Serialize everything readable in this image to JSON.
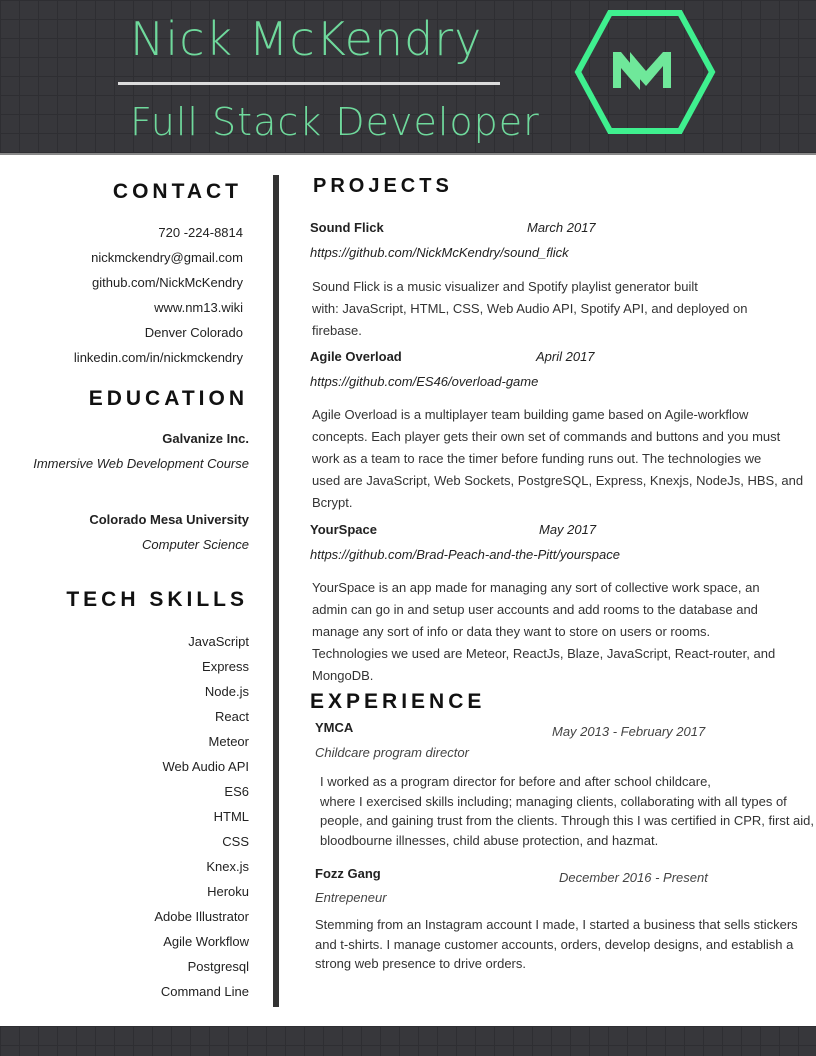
{
  "header": {
    "name": "Nick McKendry",
    "title": "Full Stack Developer",
    "logo_text": "NM",
    "accent": "#3ff08f"
  },
  "contact": {
    "heading": "CONTACT",
    "items": [
      "720 -224-8814",
      "nickmckendry@gmail.com",
      "github.com/NickMcKendry",
      "www.nm13.wiki",
      "Denver Colorado",
      "linkedin.com/in/nickmckendry"
    ]
  },
  "education": {
    "heading": "EDUCATION",
    "items": [
      {
        "school": "Galvanize Inc.",
        "program": "Immersive Web Development Course"
      },
      {
        "school": "Colorado Mesa University",
        "program": "Computer Science"
      }
    ]
  },
  "skills": {
    "heading": "TECH SKILLS",
    "items": [
      "JavaScript",
      "Express",
      "Node.js",
      "React",
      "Meteor",
      "Web Audio API",
      "ES6",
      "HTML",
      "CSS",
      "Knex.js",
      "Heroku",
      "Adobe Illustrator",
      "Agile Workflow",
      "Postgresql",
      "Command Line"
    ]
  },
  "projects": {
    "heading": "PROJECTS",
    "items": [
      {
        "name": "Sound Flick",
        "date": "March 2017",
        "url": "https://github.com/NickMcKendry/sound_flick",
        "lines": [
          "Sound Flick is a music visualizer and Spotify playlist generator built",
          "with: JavaScript, HTML, CSS, Web Audio API, Spotify API, and deployed on",
          "firebase."
        ]
      },
      {
        "name": "Agile Overload",
        "date": "April 2017",
        "url": "https://github.com/ES46/overload-game",
        "lines": [
          "Agile Overload is a multiplayer team building game based on Agile-workflow",
          "concepts. Each player gets their own set of commands and buttons and you must",
          "work as a team to race the timer before funding runs out. The technologies we",
          "used are JavaScript, Web Sockets, PostgreSQL, Express, Knexjs, NodeJs, HBS, and",
          "Bcrypt."
        ]
      },
      {
        "name": "YourSpace",
        "date": "May 2017",
        "url": "https://github.com/Brad-Peach-and-the-Pitt/yourspace",
        "lines": [
          "YourSpace is an app made for managing any sort of collective work space, an",
          "admin can go in and setup user accounts and add rooms to the database and",
          "manage any sort of info or data they want to store on users or rooms.",
          "Technologies we used are Meteor, ReactJs, Blaze, JavaScript, React-router, and",
          "MongoDB."
        ]
      }
    ]
  },
  "experience": {
    "heading": "EXPERIENCE",
    "items": [
      {
        "org": "YMCA",
        "date": "May 2013 - February 2017",
        "role": "Childcare program director",
        "lines": [
          "I worked as a program director for before and after school childcare,",
          "where I exercised skills including; managing clients, collaborating with all types of",
          "people, and gaining trust from the clients. Through this I was certified in CPR, first aid,",
          "bloodbourne illnesses, child abuse protection, and hazmat."
        ]
      },
      {
        "org": "Fozz Gang",
        "date": "December 2016 - Present",
        "role": "Entrepeneur",
        "lines": [
          "Stemming from an Instagram account I made, I started a business that sells stickers",
          "and t-shirts. I manage customer accounts, orders,  develop designs, and establish a",
          "strong web presence to drive orders."
        ]
      }
    ]
  }
}
